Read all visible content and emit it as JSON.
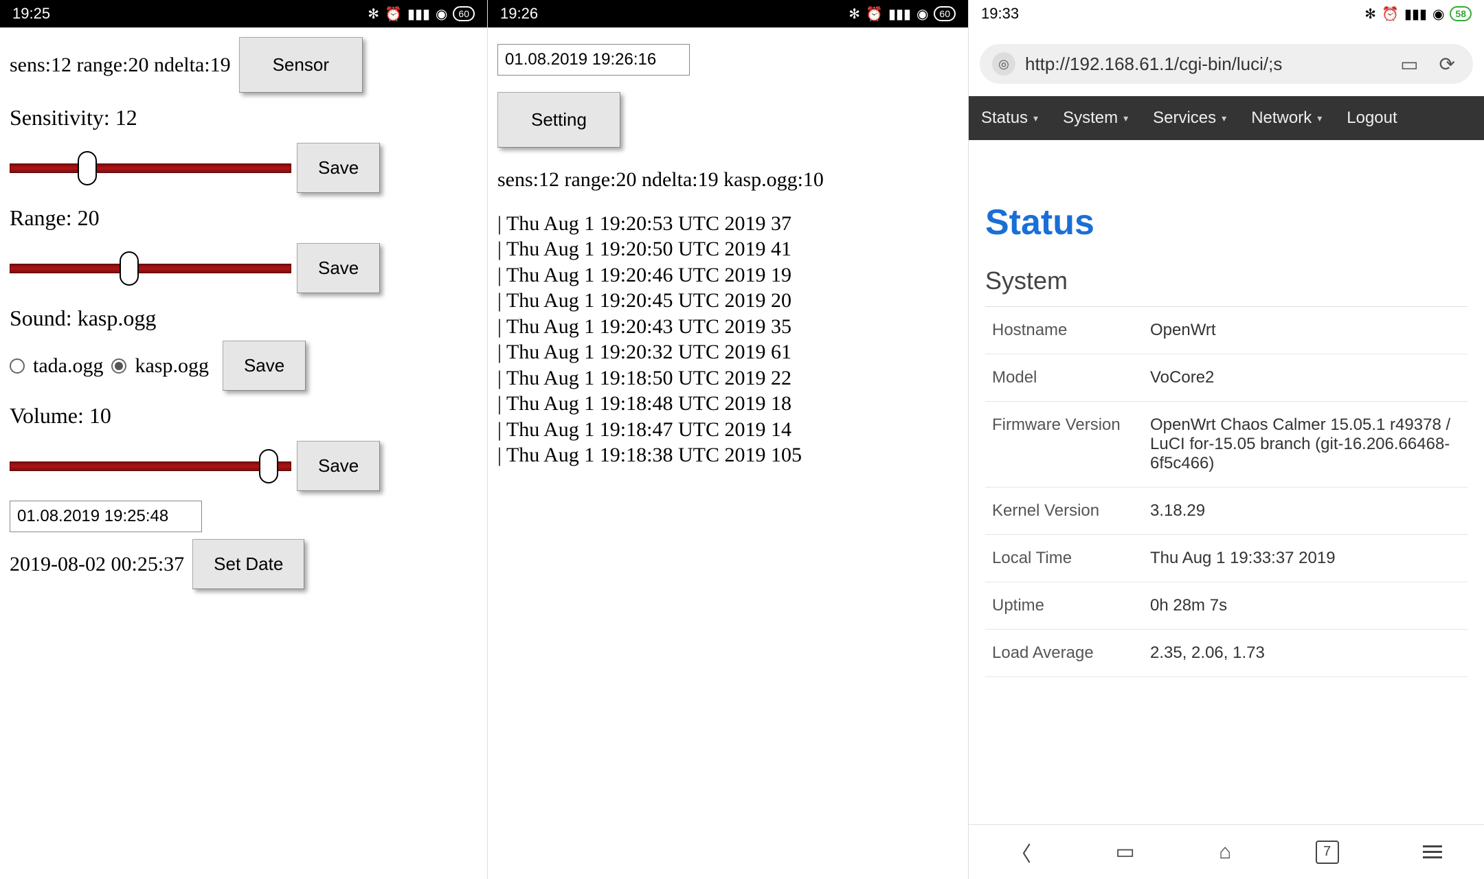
{
  "left": {
    "status": {
      "time": "19:25",
      "battery": "60"
    },
    "summary": "sens:12 range:20 ndelta:19",
    "sensor_btn": "Sensor",
    "sensitivity_label": "Sensitivity: 12",
    "sensitivity_pct": 26,
    "save_label": "Save",
    "range_label": "Range: 20",
    "range_pct": 42,
    "sound_label": "Sound: kasp.ogg",
    "radios": {
      "opt1": "tada.ogg",
      "opt2": "kasp.ogg",
      "selected": "kasp.ogg"
    },
    "volume_label": "Volume: 10",
    "volume_pct": 95,
    "date_input": "01.08.2019 19:25:48",
    "date_text": "2019-08-02 00:25:37",
    "setdate_btn": "Set Date"
  },
  "mid": {
    "status": {
      "time": "19:26",
      "battery": "60"
    },
    "date_input": "01.08.2019 19:26:16",
    "setting_btn": "Setting",
    "summary": "sens:12 range:20 ndelta:19 kasp.ogg:10",
    "log": [
      "| Thu Aug 1 19:20:53 UTC 2019 37",
      "| Thu Aug 1 19:20:50 UTC 2019 41",
      "| Thu Aug 1 19:20:46 UTC 2019 19",
      "| Thu Aug 1 19:20:45 UTC 2019 20",
      "| Thu Aug 1 19:20:43 UTC 2019 35",
      "| Thu Aug 1 19:20:32 UTC 2019 61",
      "| Thu Aug 1 19:18:50 UTC 2019 22",
      "| Thu Aug 1 19:18:48 UTC 2019 18",
      "| Thu Aug 1 19:18:47 UTC 2019 14",
      "| Thu Aug 1 19:18:38 UTC 2019 105"
    ]
  },
  "right": {
    "status": {
      "time": "19:33",
      "battery": "58"
    },
    "url": "http://192.168.61.1/cgi-bin/luci/;s",
    "nav": {
      "status": "Status",
      "system": "System",
      "services": "Services",
      "network": "Network",
      "logout": "Logout"
    },
    "title": "Status",
    "section": "System",
    "rows": [
      {
        "k": "Hostname",
        "v": "OpenWrt"
      },
      {
        "k": "Model",
        "v": "VoCore2"
      },
      {
        "k": "Firmware Version",
        "v": "OpenWrt Chaos Calmer 15.05.1 r49378 / LuCI for-15.05 branch (git-16.206.66468-6f5c466)"
      },
      {
        "k": "Kernel Version",
        "v": "3.18.29"
      },
      {
        "k": "Local Time",
        "v": "Thu Aug 1 19:33:37 2019"
      },
      {
        "k": "Uptime",
        "v": "0h 28m 7s"
      },
      {
        "k": "Load Average",
        "v": "2.35, 2.06, 1.73"
      }
    ],
    "tabcount": "7"
  }
}
